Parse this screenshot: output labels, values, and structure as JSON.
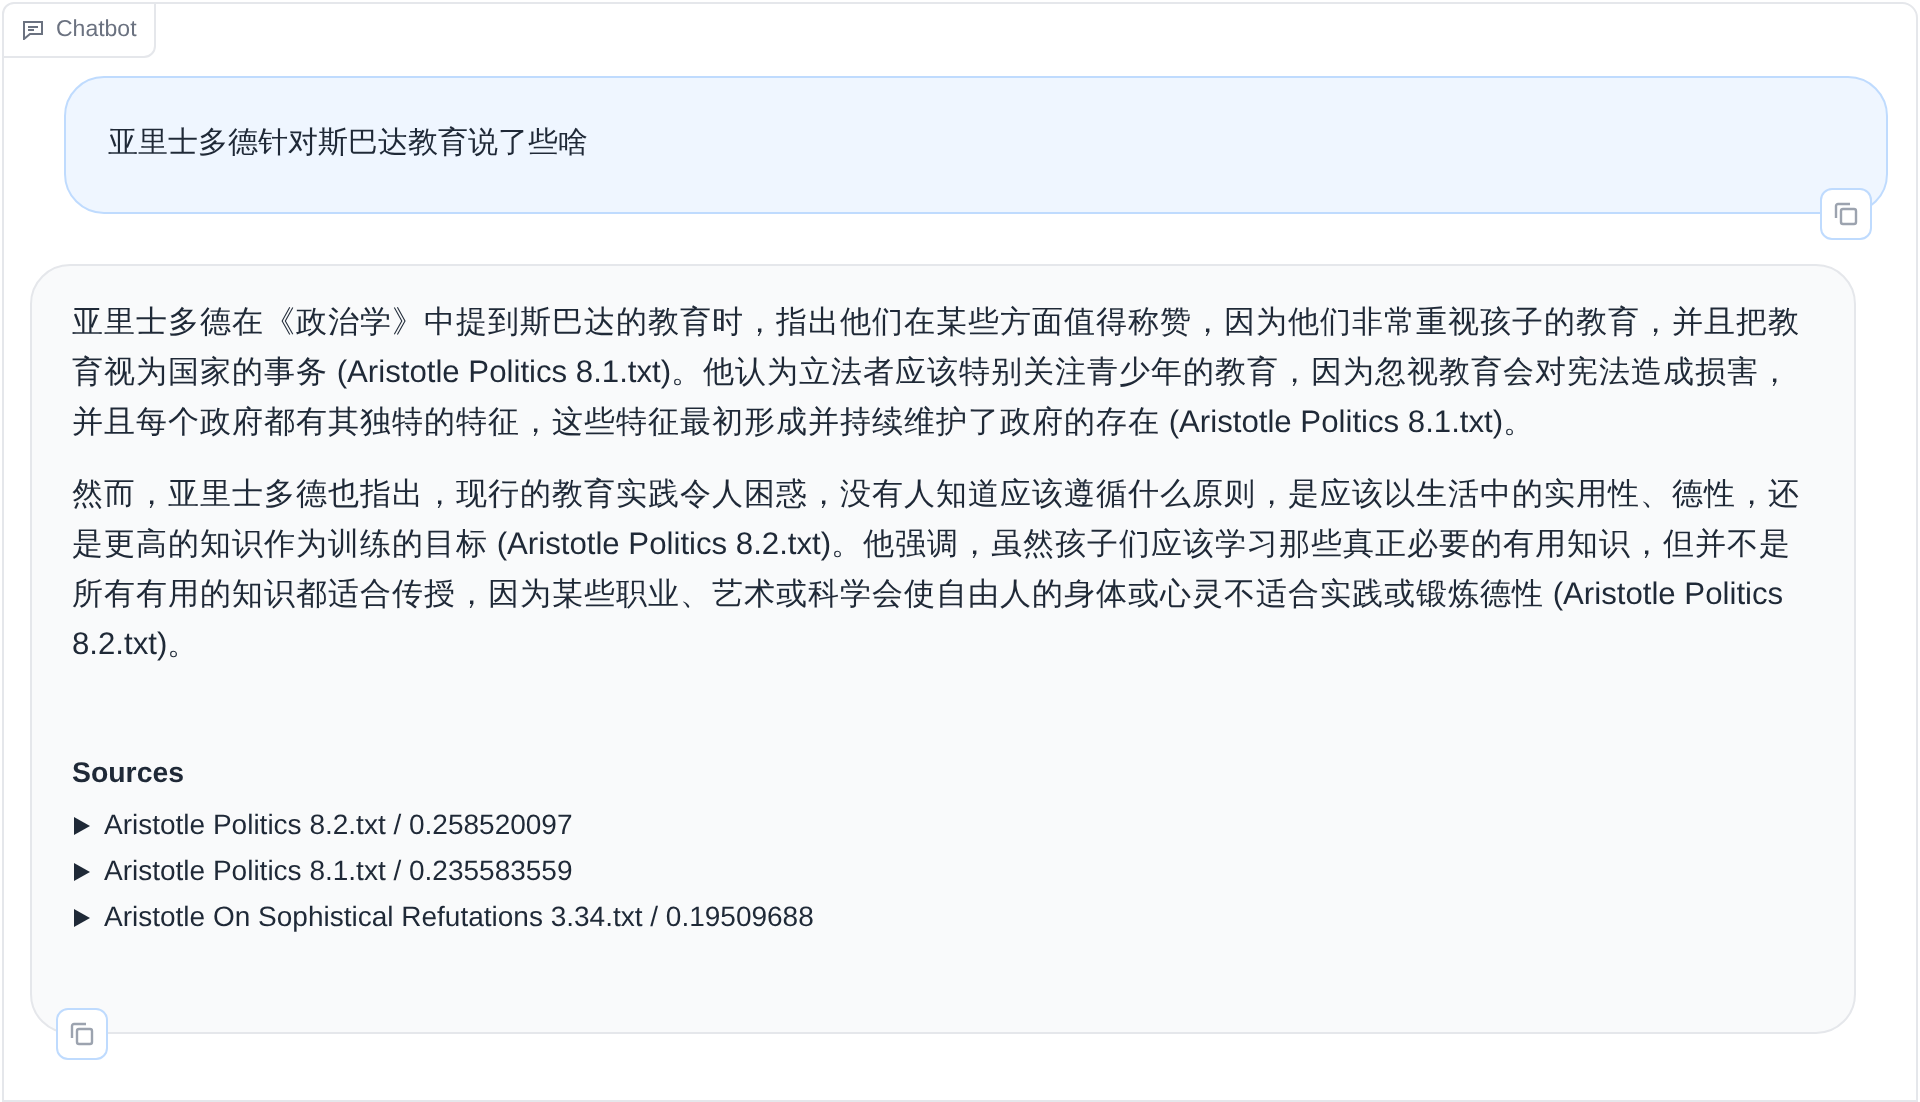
{
  "panel": {
    "label": "Chatbot"
  },
  "messages": [
    {
      "kind": "user",
      "paragraphs": [
        "亚里士多德针对斯巴达教育说了些啥"
      ]
    },
    {
      "kind": "bot",
      "paragraphs": [
        "亚里士多德在《政治学》中提到斯巴达的教育时，指出他们在某些方面值得称赞，因为他们非常重视孩子的教育，并且把教育视为国家的事务 (Aristotle Politics 8.1.txt)。他认为立法者应该特别关注青少年的教育，因为忽视教育会对宪法造成损害，并且每个政府都有其独特的特征，这些特征最初形成并持续维护了政府的存在 (Aristotle Politics 8.1.txt)。",
        "然而，亚里士多德也指出，现行的教育实践令人困惑，没有人知道应该遵循什么原则，是应该以生活中的实用性、德性，还是更高的知识作为训练的目标 (Aristotle Politics 8.2.txt)。他强调，虽然孩子们应该学习那些真正必要的有用知识，但并不是所有有用的知识都适合传授，因为某些职业、艺术或科学会使自由人的身体或心灵不适合实践或锻炼德性 (Aristotle Politics 8.2.txt)。"
      ],
      "sources_heading": "Sources",
      "sources": [
        {
          "label": "Aristotle Politics 8.2.txt / 0.258520097",
          "expanded": false
        },
        {
          "label": "Aristotle Politics 8.1.txt / 0.235583559",
          "expanded": false
        },
        {
          "label": "Aristotle On Sophistical Refutations 3.34.txt / 0.19509688",
          "expanded": false
        }
      ]
    }
  ]
}
